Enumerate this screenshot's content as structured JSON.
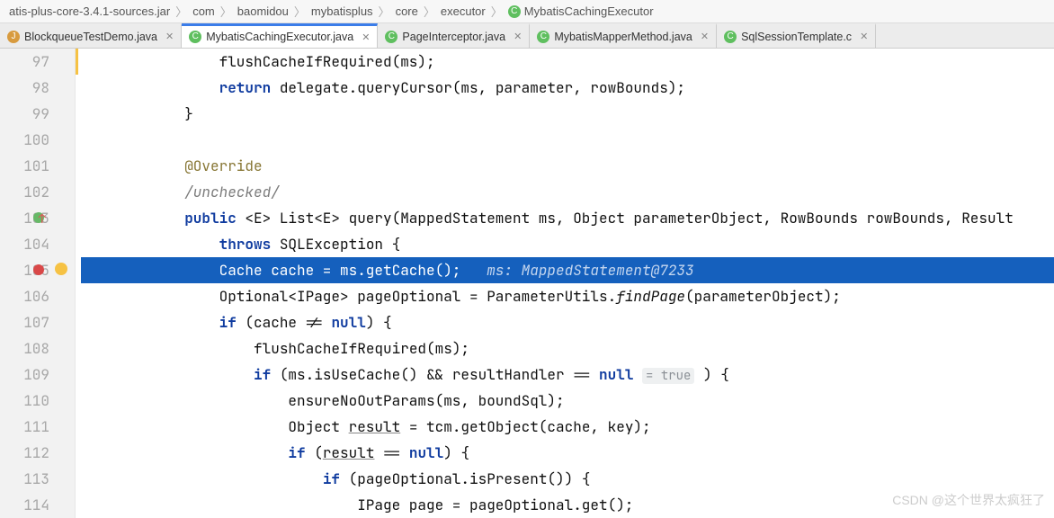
{
  "breadcrumb": [
    "atis-plus-core-3.4.1-sources.jar",
    "com",
    "baomidou",
    "mybatisplus",
    "core",
    "executor",
    "MybatisCachingExecutor"
  ],
  "tabs": [
    {
      "label": "BlockqueueTestDemo.java",
      "active": false,
      "kind": "demo"
    },
    {
      "label": "MybatisCachingExecutor.java",
      "active": true,
      "kind": "java"
    },
    {
      "label": "PageInterceptor.java",
      "active": false,
      "kind": "java"
    },
    {
      "label": "MybatisMapperMethod.java",
      "active": false,
      "kind": "java"
    },
    {
      "label": "SqlSessionTemplate.c",
      "active": false,
      "kind": "java"
    }
  ],
  "line_start": 97,
  "lines": [
    {
      "kind": "plain",
      "i": 4,
      "tokens": [
        {
          "t": "flushCacheIfRequired(ms);",
          "c": ""
        }
      ]
    },
    {
      "kind": "plain",
      "i": 4,
      "tokens": [
        {
          "t": "return ",
          "c": "k"
        },
        {
          "t": "delegate.queryCursor(ms, parameter, rowBounds);",
          "c": ""
        }
      ]
    },
    {
      "kind": "plain",
      "i": 3,
      "tokens": [
        {
          "t": "}",
          "c": ""
        }
      ]
    },
    {
      "kind": "empty"
    },
    {
      "kind": "plain",
      "i": 3,
      "tokens": [
        {
          "t": "@Override",
          "c": "a"
        }
      ]
    },
    {
      "kind": "plain",
      "i": 3,
      "tokens": [
        {
          "t": "/unchecked/",
          "c": "c"
        }
      ]
    },
    {
      "kind": "plain",
      "i": 3,
      "marks": [
        "edit",
        "arrow"
      ],
      "tokens": [
        {
          "t": "public ",
          "c": "k"
        },
        {
          "t": "<E> List<E> query(MappedStatement ms, Object parameterObject, RowBounds rowBounds, Result",
          "c": ""
        }
      ]
    },
    {
      "kind": "plain",
      "i": 4,
      "tokens": [
        {
          "t": "throws ",
          "c": "k"
        },
        {
          "t": "SQLException {",
          "c": ""
        }
      ]
    },
    {
      "kind": "hl",
      "i": 4,
      "marks": [
        "bp",
        "bulb"
      ],
      "tokens": [
        {
          "t": "Cache cache = ms.getCache();   ",
          "c": ""
        },
        {
          "t": "ms: MappedStatement@7233",
          "c": "hint"
        }
      ]
    },
    {
      "kind": "plain",
      "i": 4,
      "tokens": [
        {
          "t": "Optional<IPage> pageOptional = ParameterUtils.",
          "c": ""
        },
        {
          "t": "findPage",
          "c": "fi"
        },
        {
          "t": "(parameterObject);",
          "c": ""
        }
      ]
    },
    {
      "kind": "plain",
      "i": 4,
      "tokens": [
        {
          "t": "if ",
          "c": "k"
        },
        {
          "t": "(cache != ",
          "c": ""
        },
        {
          "t": "null",
          "c": "k"
        },
        {
          "t": ") {",
          "c": ""
        }
      ]
    },
    {
      "kind": "plain",
      "i": 5,
      "tokens": [
        {
          "t": "flushCacheIfRequired(ms);",
          "c": ""
        }
      ]
    },
    {
      "kind": "plain",
      "i": 5,
      "tokens": [
        {
          "t": "if ",
          "c": "k"
        },
        {
          "t": "(ms.isUseCache() && resultHandler == ",
          "c": ""
        },
        {
          "t": "null",
          "c": "k"
        },
        {
          "t": " ",
          "c": ""
        },
        {
          "t": "= true",
          "c": "inl"
        },
        {
          "t": " ) {",
          "c": ""
        }
      ]
    },
    {
      "kind": "plain",
      "i": 6,
      "tokens": [
        {
          "t": "ensureNoOutParams(ms, boundSql);",
          "c": ""
        }
      ]
    },
    {
      "kind": "plain",
      "i": 6,
      "tokens": [
        {
          "t": "Object ",
          "c": ""
        },
        {
          "t": "result",
          "c": "ul"
        },
        {
          "t": " = tcm.getObject(cache, key);",
          "c": ""
        }
      ]
    },
    {
      "kind": "plain",
      "i": 6,
      "tokens": [
        {
          "t": "if ",
          "c": "k"
        },
        {
          "t": "(",
          "c": ""
        },
        {
          "t": "result",
          "c": "ul"
        },
        {
          "t": " == ",
          "c": ""
        },
        {
          "t": "null",
          "c": "k"
        },
        {
          "t": ") {",
          "c": ""
        }
      ]
    },
    {
      "kind": "plain",
      "i": 7,
      "tokens": [
        {
          "t": "if ",
          "c": "k"
        },
        {
          "t": "(pageOptional.isPresent()) {",
          "c": ""
        }
      ]
    },
    {
      "kind": "plain",
      "i": 8,
      "tokens": [
        {
          "t": "IPage page = pageOptional.get();",
          "c": ""
        }
      ]
    }
  ],
  "watermark": "CSDN @这个世界太疯狂了"
}
